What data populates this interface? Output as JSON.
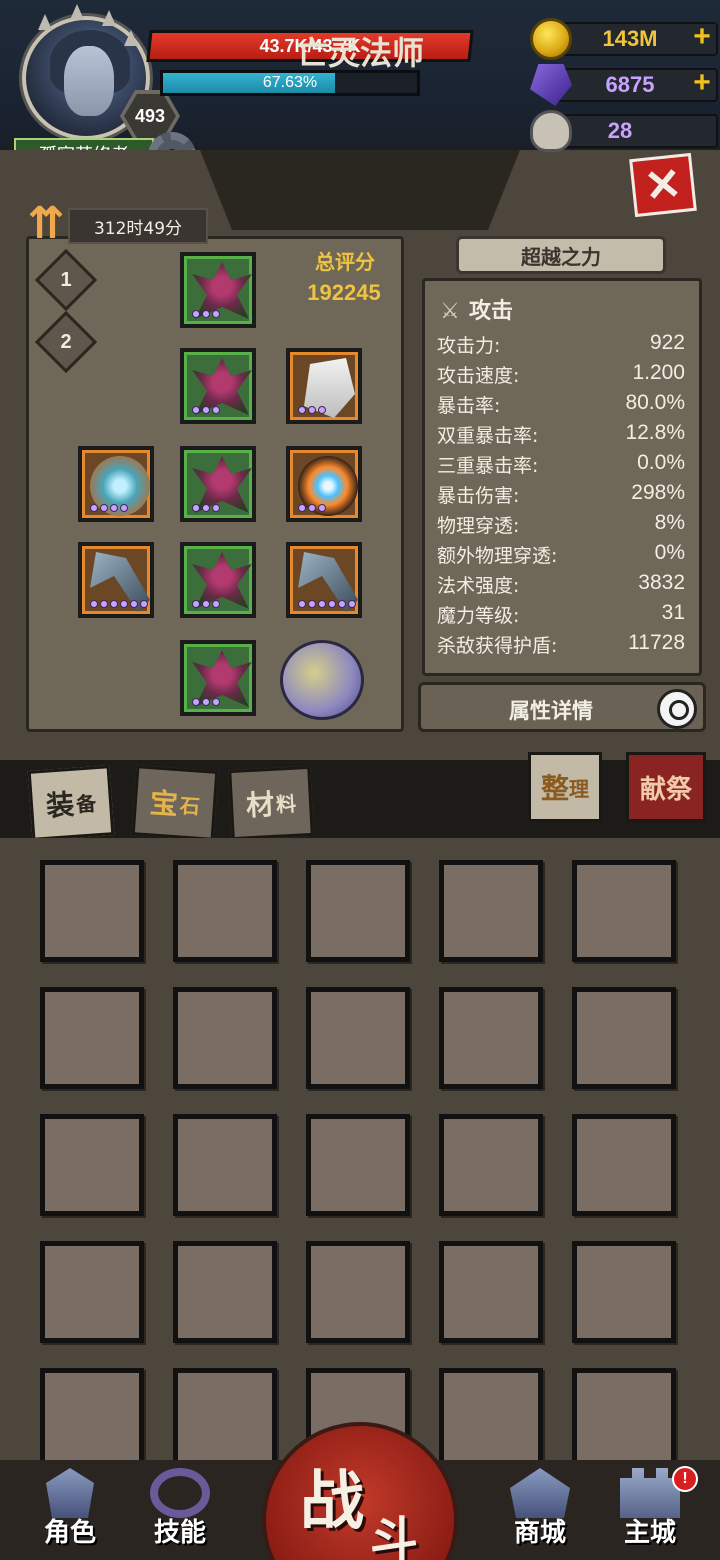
{
  "player": {
    "name": "孤寂苦修者",
    "level": "493",
    "hp_text": "43.7K/43.7K",
    "hp_fraction": 1.0,
    "xp_text": "67.63%",
    "xp_fraction": 0.6763
  },
  "resources": {
    "gold": "143M",
    "gems": "6875",
    "souls": "28",
    "plus": "+"
  },
  "panel": {
    "title": "亡灵法师",
    "timer": "312时49分",
    "presets": [
      "1",
      "2"
    ],
    "score_label": "总评分",
    "score_value": "192245",
    "transcend_label": "超越之力",
    "close_label": "✕"
  },
  "stats": {
    "header": "攻击",
    "rows": [
      {
        "label": "攻击力:",
        "value": "922"
      },
      {
        "label": "攻击速度:",
        "value": "1.200"
      },
      {
        "label": "暴击率:",
        "value": "80.0%"
      },
      {
        "label": "双重暴击率:",
        "value": "12.8%"
      },
      {
        "label": "三重暴击率:",
        "value": "0.0%"
      },
      {
        "label": "暴击伤害:",
        "value": "298%"
      },
      {
        "label": "物理穿透:",
        "value": "8%"
      },
      {
        "label": "额外物理穿透:",
        "value": "0%"
      },
      {
        "label": "法术强度:",
        "value": "3832"
      },
      {
        "label": "魔力等级:",
        "value": "31"
      },
      {
        "label": "杀敌获得护盾:",
        "value": "11728"
      }
    ],
    "details_label": "属性详情"
  },
  "equipment_icons": [
    "horned-helm",
    "spiked-chest",
    "white-glove",
    "crystal-amulet",
    "spiked-armor",
    "fire-ice-orb",
    "scythe-left",
    "spiked-legs",
    "scythe-right",
    "spiked-boots",
    "gold-coin-relic"
  ],
  "inventory": {
    "tabs": [
      {
        "main": "装",
        "small": "备"
      },
      {
        "main": "宝",
        "small": "石"
      },
      {
        "main": "材",
        "small": "料"
      }
    ],
    "sort_main": "整",
    "sort_small": "理",
    "sacrifice": "献祭"
  },
  "nav": {
    "character": "角色",
    "skills": "技能",
    "battle_1": "战",
    "battle_2": "斗",
    "shop": "商城",
    "main_city": "主城",
    "alert": "!"
  },
  "colors": {
    "hp": "#d8281c",
    "xp": "#25a0bc",
    "gold_text": "#f0c440",
    "gem_text": "#c7a3ff",
    "accent_red": "#c2211e"
  }
}
